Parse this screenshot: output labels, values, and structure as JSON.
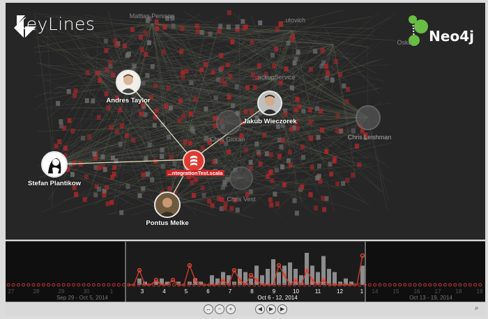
{
  "app": {
    "brand_left": "KeyLines",
    "brand_right": "Neo4j"
  },
  "graph": {
    "center_node": {
      "label": "...ntegrationTest.scala",
      "icon": "scala-file-icon",
      "color": "#e03a2f"
    },
    "people": [
      {
        "id": "andres",
        "label": "Andres Taylor"
      },
      {
        "id": "jakub",
        "label": "Jakub Wieczorek"
      },
      {
        "id": "stefan",
        "label": "Stefan Plantikow"
      },
      {
        "id": "pontus",
        "label": "Pontus Melke"
      }
    ],
    "background_people": [
      {
        "label": "Mattias Persson"
      },
      {
        "label": "Chris Gioran"
      },
      {
        "label": "Chris Leishman"
      },
      {
        "label": "Chris Vest"
      },
      {
        "label": "Oska"
      },
      {
        "label": "...utovich"
      },
      {
        "label": "...ackupService"
      }
    ],
    "colors": {
      "background": "#262626",
      "file_nodes": "#a5282b",
      "edges": "#e8e4c0"
    }
  },
  "timebar": {
    "ranges": [
      {
        "label": "Sep 29 - Oct 5, 2014",
        "active": false
      },
      {
        "label": "Oct 6 - 12, 2014",
        "active": true
      },
      {
        "label": "Oct 13 - 19, 2014",
        "active": false
      }
    ],
    "ticks_left": [
      "27",
      "28",
      "29",
      "30",
      "1"
    ],
    "ticks_main": [
      "3",
      "4",
      "5",
      "6",
      "7",
      "8",
      "9",
      "10",
      "11",
      "12",
      "1"
    ],
    "ticks_right": [
      "14",
      "15",
      "16",
      "17",
      "18",
      "19"
    ],
    "histogram": [
      0,
      0,
      2,
      1,
      0,
      1,
      2,
      1,
      0,
      1,
      0,
      1,
      2,
      1,
      0,
      3,
      2,
      4,
      3,
      1,
      5,
      4,
      2,
      6,
      3,
      5,
      8,
      4,
      6,
      7,
      5,
      3,
      10,
      6,
      4,
      9,
      5,
      4,
      1,
      2,
      1,
      0,
      6
    ],
    "selection_line": [
      0,
      0,
      3,
      0,
      0,
      1,
      0,
      0,
      1,
      0,
      0,
      4,
      1,
      0,
      0,
      0,
      0,
      1,
      0,
      3,
      1,
      0,
      2,
      1,
      0,
      0,
      0,
      4,
      2,
      0,
      1,
      0,
      3,
      1,
      0,
      1,
      0,
      0,
      0,
      0,
      0,
      0,
      6
    ],
    "controls": {
      "fit": "fit-icon",
      "zoom_out": "zoom-out-icon",
      "zoom_in": "zoom-in-icon",
      "back": "step-back-icon",
      "play": "play-icon",
      "forward": "step-forward-icon",
      "search": "search-icon"
    }
  }
}
